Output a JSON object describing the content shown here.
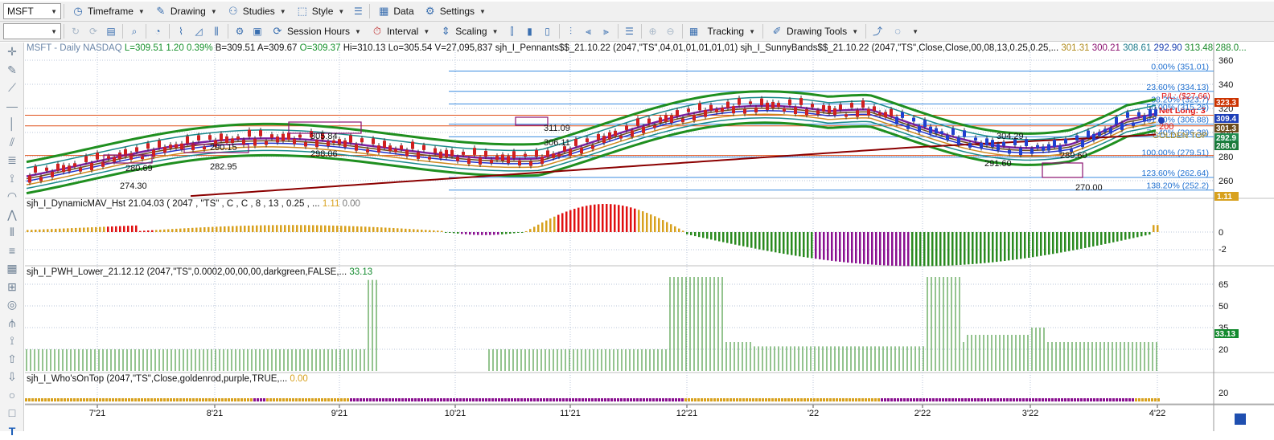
{
  "toolbar1": {
    "symbol": "MSFT",
    "items": [
      {
        "label": "Timeframe",
        "icon": "clock-icon"
      },
      {
        "label": "Drawing",
        "icon": "pencil-icon"
      },
      {
        "label": "Studies",
        "icon": "person-chart-icon"
      },
      {
        "label": "Style",
        "icon": "style-icon"
      },
      {
        "label": "Data",
        "icon": "grid-icon"
      },
      {
        "label": "Settings",
        "icon": "gear-icon"
      }
    ]
  },
  "toolbar2": {
    "items": [
      {
        "label": "Session Hours"
      },
      {
        "label": "Interval"
      },
      {
        "label": "Scaling"
      },
      {
        "label": "Tracking"
      },
      {
        "label": "Drawing Tools"
      }
    ]
  },
  "header": {
    "symbol_line": "MSFT - Daily  NASDAQ",
    "last": "L=309.51",
    "chg": "1.20",
    "pct": "0.39%",
    "bid": "B=309.51",
    "ask": "A=309.67",
    "open": "O=309.37",
    "hi": "Hi=310.13",
    "lo": "Lo=305.54",
    "vol": "V=27,095,837",
    "study1": "sjh_I_Pennants$$_21.10.22 (2047,\"TS\",04,01,01,01,01,01)",
    "study2": "sjh_I_SunnyBands$$_21.10.22 (2047,\"TS\",Close,Close,00,08,13,0.25,0.25,...",
    "v1": "301.31",
    "v2": "300.21",
    "v3": "308.61",
    "v4": "292.90",
    "v5": "313.48",
    "v6": "288.0..."
  },
  "panes": {
    "p2_title": "sjh_I_DynamicMAV_Hst 21.04.03 ( 2047 , \"TS\" , C , C ,  8 , 13 , 0.25 , ...",
    "p2_v1": "1.11",
    "p2_v2": "0.00",
    "p3_title": "sjh_I_PWH_Lower_21.12.12 (2047,\"TS\",0.0002,00,00,00,darkgreen,FALSE,...",
    "p3_v1": "33.13",
    "p4_title": "sjh_I_Who'sOnTop (2047,\"TS\",Close,goldenrod,purple,TRUE,...",
    "p4_v1": "0.00"
  },
  "fib": {
    "labels": [
      "0.00% (351.01)",
      "23.60% (334.13)",
      "38.20% (323.7)",
      "61.80% (306.88)",
      "76.40% (296.38)",
      "100.00% (279.51)",
      "123.60% (262.64)",
      "138.20% (252.2)"
    ],
    "overlay1": "P/L: ($27.66)",
    "overlay2": "Net Long: 3",
    "overlay3": "50.00% (315.26)",
    "golden": "GOLDEN TOP",
    "tag200": "200"
  },
  "price_labels": [
    "280.69",
    "274.30",
    "290.15",
    "282.95",
    "305.84",
    "298.06",
    "311.09",
    "306.11",
    "304.29",
    "291.60",
    "289.60",
    "270.00"
  ],
  "axes": {
    "price_ticks": [
      "360",
      "340",
      "320",
      "300",
      "280",
      "260"
    ],
    "hist_ticks": [
      "0",
      "-2"
    ],
    "pwh_ticks": [
      "65",
      "50",
      "35",
      "20"
    ],
    "wot_ticks": [
      "20"
    ],
    "date_ticks": [
      "7'21",
      "8'21",
      "9'21",
      "10'21",
      "11'21",
      "12'21",
      "'22",
      "2'22",
      "3'22",
      "4'22"
    ]
  },
  "axis_badges": [
    {
      "text": "323.3",
      "color": "#cc3300"
    },
    {
      "text": "309.4",
      "color": "#1d3fb8"
    },
    {
      "text": "301.3",
      "color": "#6b4a1a"
    },
    {
      "text": "292.9",
      "color": "#1f8a4c"
    },
    {
      "text": "288.0",
      "color": "#1a7a3a"
    },
    {
      "text": "1.11",
      "color": "#d8a11e"
    },
    {
      "text": "33.13",
      "color": "#138a2e"
    }
  ],
  "colors": {
    "green_band": "#1f8f1f",
    "teal_band": "#1a8a8a",
    "purple_ma": "#7a1fa2",
    "blue_ma": "#2233cc",
    "orange_ma": "#d08a1f",
    "long_ma": "#8b0000",
    "up_candle": "#1f3fd0",
    "down_candle": "#d01f1f",
    "hist_gold": "#d8a11e",
    "hist_red": "#e01010",
    "hist_purple": "#8a1090",
    "hist_green": "#2a8a1f",
    "pwh_green": "#2a8a1f",
    "wot_gold": "#d8a11e",
    "wot_purple": "#8a1090"
  }
}
